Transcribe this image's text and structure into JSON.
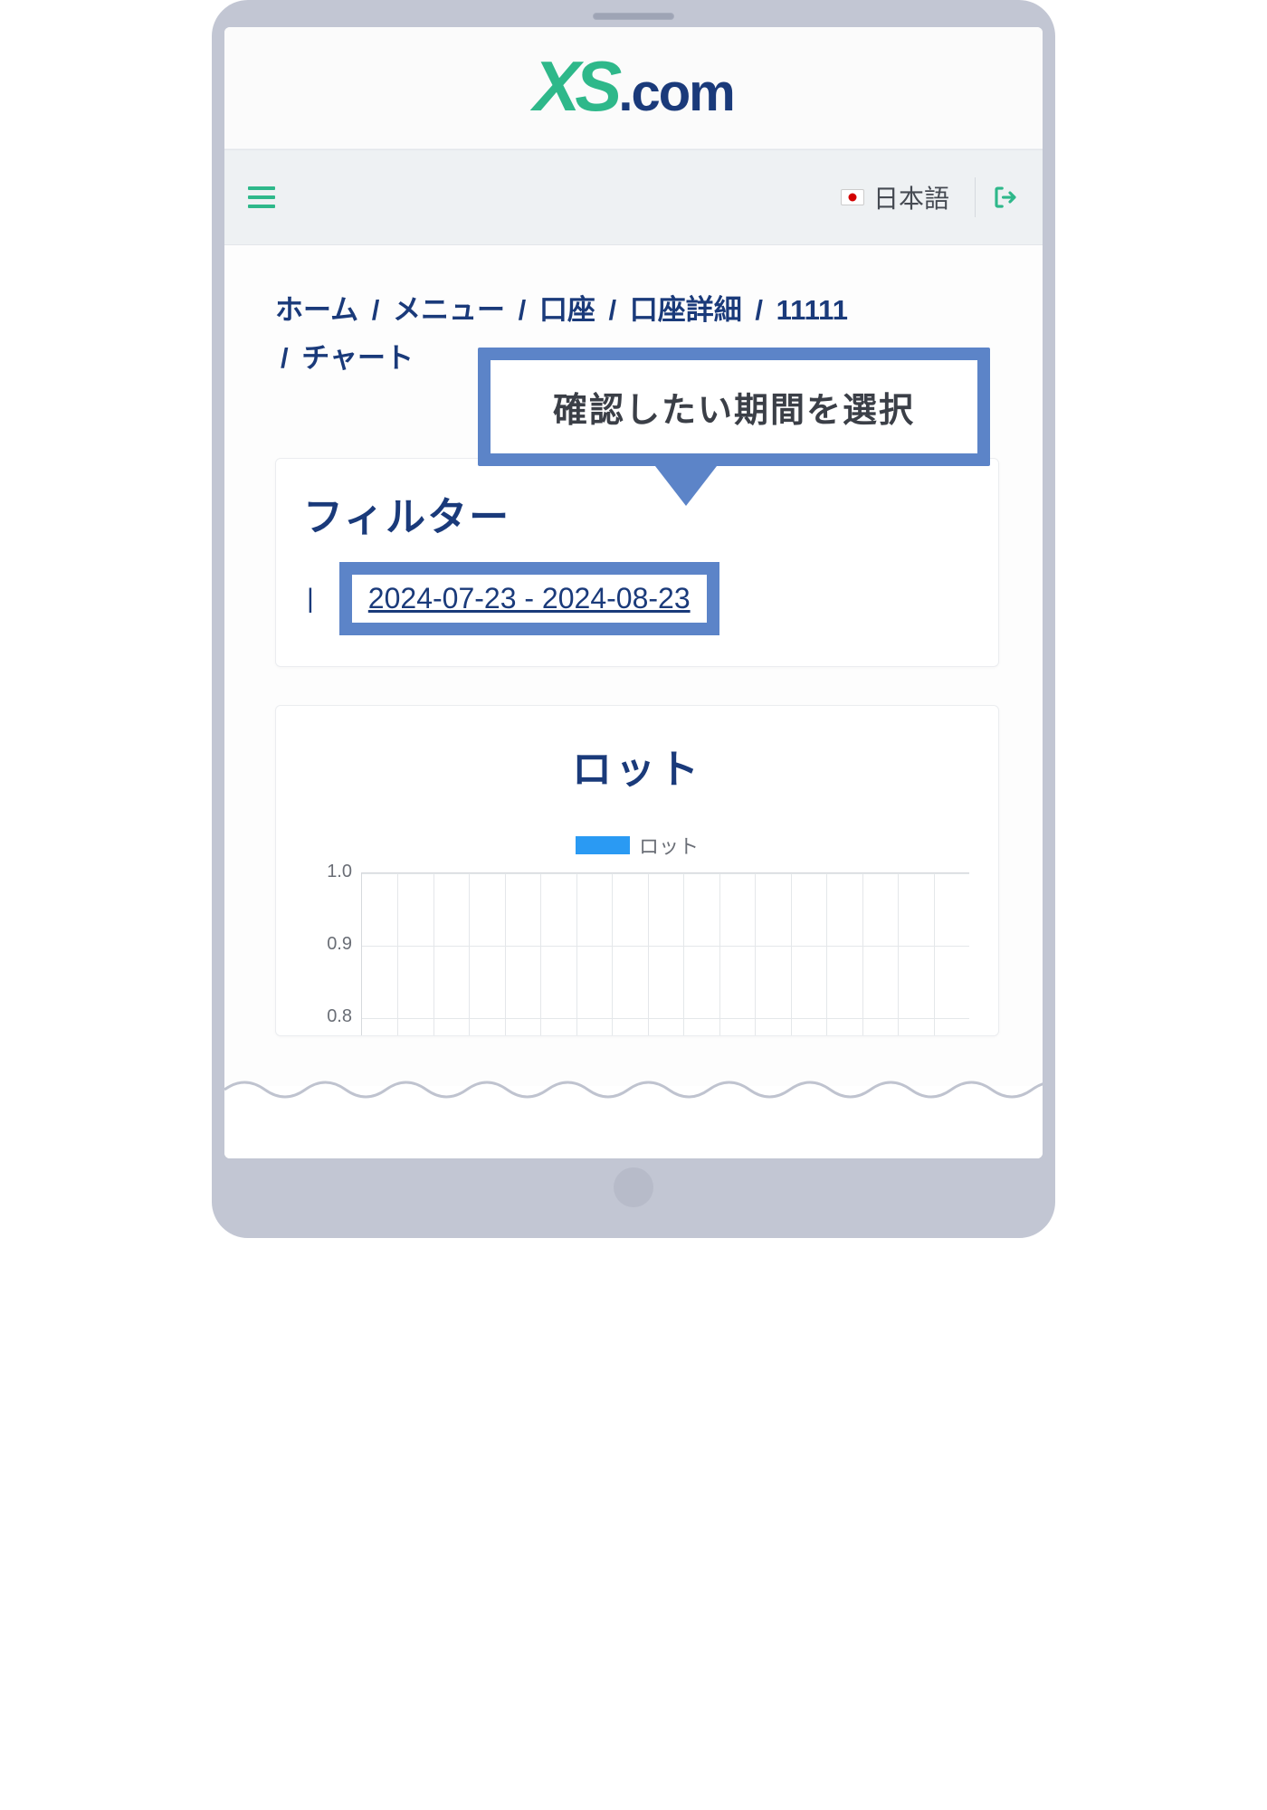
{
  "logo": {
    "xs": "XS",
    "com": ".com"
  },
  "nav": {
    "language_label": "日本語"
  },
  "breadcrumb": {
    "items": [
      "ホーム",
      "メニュー",
      "口座",
      "口座詳細",
      "11111"
    ],
    "current": "チャート",
    "separator": "/"
  },
  "callout": {
    "text": "確認したい期間を選択"
  },
  "filter": {
    "title": "フィルター",
    "separator": "|",
    "date_range": "2024-07-23 - 2024-08-23"
  },
  "chart_card": {
    "title": "ロット",
    "legend_label": "ロット"
  },
  "chart_data": {
    "type": "bar",
    "title": "ロット",
    "series": [
      {
        "name": "ロット",
        "values": []
      }
    ],
    "categories": [],
    "ylabel": "",
    "xlabel": "",
    "ylim": [
      0.8,
      1.0
    ],
    "yticks": [
      1.0,
      0.9,
      0.8
    ],
    "legend_position": "top",
    "grid": true
  },
  "colors": {
    "brand_green": "#2eb88a",
    "brand_navy": "#1a3a7a",
    "callout_blue": "#5c84c8",
    "chart_blue": "#2a9af3"
  }
}
